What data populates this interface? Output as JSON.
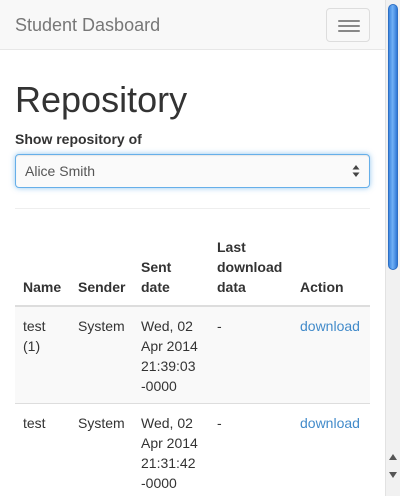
{
  "navbar": {
    "brand": "Student Dasboard",
    "toggle_icon": "hamburger-icon"
  },
  "page": {
    "title": "Repository",
    "select_label": "Show repository of",
    "selected_student": "Alice Smith"
  },
  "table": {
    "headers": {
      "name": "Name",
      "sender": "Sender",
      "sent_date": [
        "Sent",
        "date"
      ],
      "last_download": [
        "Last",
        "download",
        "data"
      ],
      "action": "Action"
    },
    "rows": [
      {
        "name": [
          "test",
          "(1)"
        ],
        "sender": "System",
        "sent_date": [
          "Wed, 02",
          "Apr 2014",
          "21:39:03",
          "-0000"
        ],
        "last_download": "-",
        "action": "download"
      },
      {
        "name": [
          "test"
        ],
        "sender": "System",
        "sent_date": [
          "Wed, 02",
          "Apr 2014",
          "21:31:42",
          "-0000"
        ],
        "last_download": "-",
        "action": "download"
      }
    ]
  },
  "colors": {
    "navbar_bg": "#f8f8f8",
    "link": "#428bca",
    "focus_border": "#66afe9",
    "row_alt_bg": "#f9f9f9",
    "scroll_thumb": "#4a90e2"
  }
}
